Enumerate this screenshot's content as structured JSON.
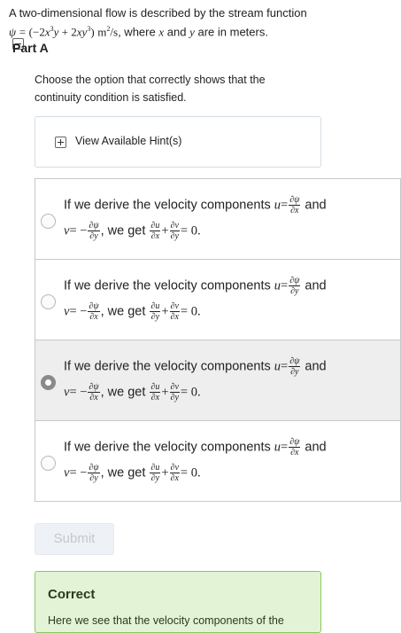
{
  "problem": {
    "line1": "A two-dimensional flow is described by the stream function",
    "psi": "ψ",
    "eq": "=",
    "open_paren": "(−2",
    "x1": "x",
    "exp3a": "3",
    "y1": "y",
    "plus": " + 2",
    "x2": "x",
    "y2": "y",
    "exp3b": "3",
    "close_paren": ")",
    "units": "m",
    "exp2": "2",
    "per_s": "/s",
    "where_prefix": ", where",
    "x3": "x",
    "and": "and",
    "y3": "y",
    "suffix": "are in meters."
  },
  "part": {
    "label": "Part A"
  },
  "question": "Choose the option that correctly shows that the continuity condition is satisfied.",
  "hints": {
    "label": "View Available Hint(s)"
  },
  "options": [
    {
      "text1": "If we derive the velocity components",
      "u": "u",
      "eq": "=",
      "u_num": "∂ψ",
      "u_den": "∂x",
      "and": "and",
      "v": "v",
      "eq2": "= −",
      "v_num": "∂ψ",
      "v_den": "∂y",
      "we_get": ", we get",
      "a_num": "∂u",
      "a_den": "∂x",
      "plus": "+",
      "b_num": "∂v",
      "b_den": "∂y",
      "result": "= 0."
    },
    {
      "text1": "If we derive the velocity components",
      "u": "u",
      "eq": "=",
      "u_num": "∂ψ",
      "u_den": "∂y",
      "and": "and",
      "v": "v",
      "eq2": "= −",
      "v_num": "∂ψ",
      "v_den": "∂x",
      "we_get": ", we get",
      "a_num": "∂u",
      "a_den": "∂y",
      "plus": "+",
      "b_num": "∂v",
      "b_den": "∂x",
      "result": "= 0."
    },
    {
      "text1": "If we derive the velocity components",
      "u": "u",
      "eq": "=",
      "u_num": "∂ψ",
      "u_den": "∂y",
      "and": "and",
      "v": "v",
      "eq2": "= −",
      "v_num": "∂ψ",
      "v_den": "∂x",
      "we_get": ", we get",
      "a_num": "∂u",
      "a_den": "∂x",
      "plus": "+",
      "b_num": "∂v",
      "b_den": "∂y",
      "result": "= 0."
    },
    {
      "text1": "If we derive the velocity components",
      "u": "u",
      "eq": "=",
      "u_num": "∂ψ",
      "u_den": "∂x",
      "and": "and",
      "v": "v",
      "eq2": "= −",
      "v_num": "∂ψ",
      "v_den": "∂y",
      "we_get": ", we get",
      "a_num": "∂u",
      "a_den": "∂y",
      "plus": "+",
      "b_num": "∂v",
      "b_den": "∂x",
      "result": "= 0."
    }
  ],
  "selected_option": 2,
  "submit": {
    "label": "Submit"
  },
  "feedback": {
    "title": "Correct",
    "cut_text": "Here we see that the velocity components of the"
  },
  "colors": {
    "feedback_bg": "#e3f4d6",
    "feedback_border": "#8cc665",
    "selected_bg": "#eeeeee"
  }
}
